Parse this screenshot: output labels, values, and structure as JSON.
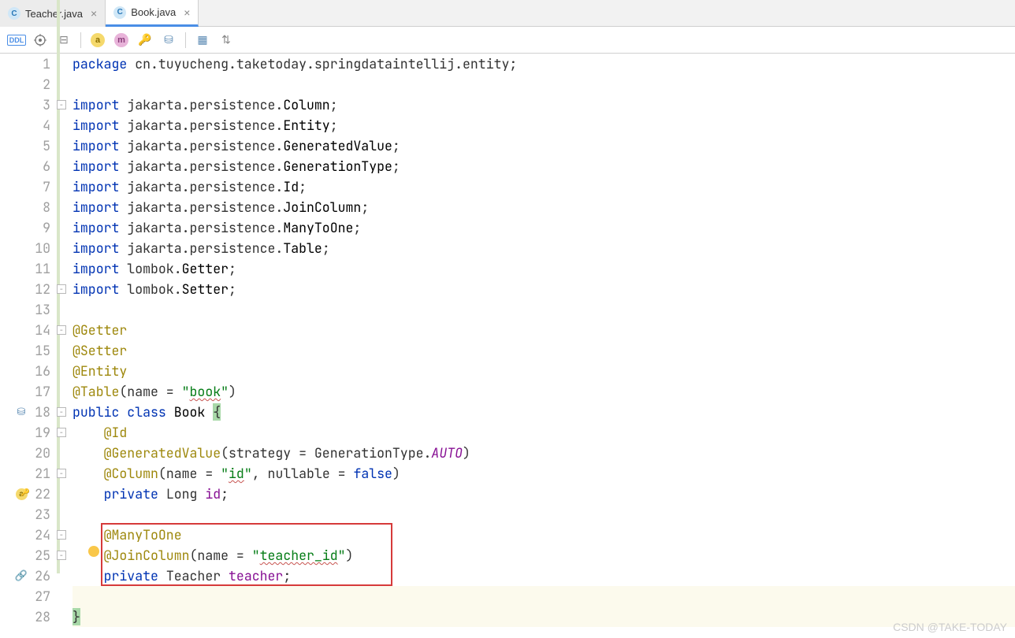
{
  "tabs": [
    {
      "label": "Teacher.java",
      "active": false
    },
    {
      "label": "Book.java",
      "active": true
    }
  ],
  "toolbar": {
    "items": [
      "ddl",
      "target",
      "structure",
      "sep",
      "a-badge",
      "m-badge",
      "key",
      "db-search",
      "sep",
      "db-grid",
      "arrows"
    ]
  },
  "watermark": "CSDN @TAKE-TODAY",
  "code": {
    "lines": [
      {
        "n": 1,
        "tokens": [
          [
            "kw",
            "package"
          ],
          [
            "txt",
            " cn.tuyucheng.taketoday.springdataintellij.entity;"
          ]
        ]
      },
      {
        "n": 2,
        "tokens": []
      },
      {
        "n": 3,
        "tokens": [
          [
            "kw",
            "import"
          ],
          [
            "txt",
            " jakarta.persistence."
          ],
          [
            "cls",
            "Column"
          ],
          [
            "txt",
            ";"
          ]
        ],
        "fold": "start"
      },
      {
        "n": 4,
        "tokens": [
          [
            "kw",
            "import"
          ],
          [
            "txt",
            " jakarta.persistence."
          ],
          [
            "cls",
            "Entity"
          ],
          [
            "txt",
            ";"
          ]
        ]
      },
      {
        "n": 5,
        "tokens": [
          [
            "kw",
            "import"
          ],
          [
            "txt",
            " jakarta.persistence."
          ],
          [
            "cls",
            "GeneratedValue"
          ],
          [
            "txt",
            ";"
          ]
        ]
      },
      {
        "n": 6,
        "tokens": [
          [
            "kw",
            "import"
          ],
          [
            "txt",
            " jakarta.persistence."
          ],
          [
            "cls",
            "GenerationType"
          ],
          [
            "txt",
            ";"
          ]
        ]
      },
      {
        "n": 7,
        "tokens": [
          [
            "kw",
            "import"
          ],
          [
            "txt",
            " jakarta.persistence."
          ],
          [
            "cls",
            "Id"
          ],
          [
            "txt",
            ";"
          ]
        ]
      },
      {
        "n": 8,
        "tokens": [
          [
            "kw",
            "import"
          ],
          [
            "txt",
            " jakarta.persistence."
          ],
          [
            "cls",
            "JoinColumn"
          ],
          [
            "txt",
            ";"
          ]
        ]
      },
      {
        "n": 9,
        "tokens": [
          [
            "kw",
            "import"
          ],
          [
            "txt",
            " jakarta.persistence."
          ],
          [
            "cls",
            "ManyToOne"
          ],
          [
            "txt",
            ";"
          ]
        ]
      },
      {
        "n": 10,
        "tokens": [
          [
            "kw",
            "import"
          ],
          [
            "txt",
            " jakarta.persistence."
          ],
          [
            "cls",
            "Table"
          ],
          [
            "txt",
            ";"
          ]
        ]
      },
      {
        "n": 11,
        "tokens": [
          [
            "kw",
            "import"
          ],
          [
            "txt",
            " lombok."
          ],
          [
            "cls",
            "Getter"
          ],
          [
            "txt",
            ";"
          ]
        ]
      },
      {
        "n": 12,
        "tokens": [
          [
            "kw",
            "import"
          ],
          [
            "txt",
            " lombok."
          ],
          [
            "cls",
            "Setter"
          ],
          [
            "txt",
            ";"
          ]
        ],
        "fold": "end"
      },
      {
        "n": 13,
        "tokens": []
      },
      {
        "n": 14,
        "tokens": [
          [
            "ann",
            "@Getter"
          ]
        ],
        "fold": "start"
      },
      {
        "n": 15,
        "tokens": [
          [
            "ann",
            "@Setter"
          ]
        ]
      },
      {
        "n": 16,
        "tokens": [
          [
            "ann",
            "@Entity"
          ]
        ]
      },
      {
        "n": 17,
        "tokens": [
          [
            "ann",
            "@Table"
          ],
          [
            "txt",
            "(name = "
          ],
          [
            "str",
            "\""
          ],
          [
            "str-wavy",
            "book"
          ],
          [
            "str",
            "\""
          ],
          [
            "txt",
            ")"
          ]
        ]
      },
      {
        "n": 18,
        "tokens": [
          [
            "kw",
            "public class "
          ],
          [
            "cls",
            "Book "
          ],
          [
            "brace",
            "{"
          ]
        ],
        "icon": "db-table",
        "fold": "start"
      },
      {
        "n": 19,
        "tokens": [
          [
            "txt",
            "    "
          ],
          [
            "ann",
            "@Id"
          ]
        ],
        "fold": "start"
      },
      {
        "n": 20,
        "tokens": [
          [
            "txt",
            "    "
          ],
          [
            "ann",
            "@GeneratedValue"
          ],
          [
            "txt",
            "(strategy = GenerationType."
          ],
          [
            "const",
            "AUTO"
          ],
          [
            "txt",
            ")"
          ]
        ]
      },
      {
        "n": 21,
        "tokens": [
          [
            "txt",
            "    "
          ],
          [
            "ann",
            "@Column"
          ],
          [
            "txt",
            "(name = "
          ],
          [
            "str",
            "\""
          ],
          [
            "str-wavy",
            "id"
          ],
          [
            "str",
            "\""
          ],
          [
            "txt",
            ", nullable = "
          ],
          [
            "kw",
            "false"
          ],
          [
            "txt",
            ")"
          ]
        ],
        "fold": "end"
      },
      {
        "n": 22,
        "tokens": [
          [
            "txt",
            "    "
          ],
          [
            "kw",
            "private"
          ],
          [
            "txt",
            " Long "
          ],
          [
            "ident",
            "id"
          ],
          [
            "txt",
            ";"
          ]
        ],
        "icon": "a-key"
      },
      {
        "n": 23,
        "tokens": []
      },
      {
        "n": 24,
        "tokens": [
          [
            "txt",
            "    "
          ],
          [
            "ann",
            "@ManyToOne"
          ]
        ],
        "fold": "start"
      },
      {
        "n": 25,
        "tokens": [
          [
            "txt",
            "    "
          ],
          [
            "ann",
            "@JoinColumn"
          ],
          [
            "txt",
            "(name = "
          ],
          [
            "str",
            "\""
          ],
          [
            "str-wavy",
            "teacher_id"
          ],
          [
            "str",
            "\""
          ],
          [
            "txt",
            ")"
          ]
        ],
        "fold": "end"
      },
      {
        "n": 26,
        "tokens": [
          [
            "txt",
            "    "
          ],
          [
            "kw",
            "private"
          ],
          [
            "txt",
            " Teacher "
          ],
          [
            "ident",
            "teacher"
          ],
          [
            "txt",
            ";"
          ]
        ],
        "icon": "link"
      },
      {
        "n": 27,
        "tokens": [],
        "highlight": true
      },
      {
        "n": 28,
        "tokens": [
          [
            "brace",
            "}"
          ]
        ],
        "highlight": true
      }
    ]
  },
  "redbox": {
    "startLine": 24,
    "endLine": 26
  }
}
